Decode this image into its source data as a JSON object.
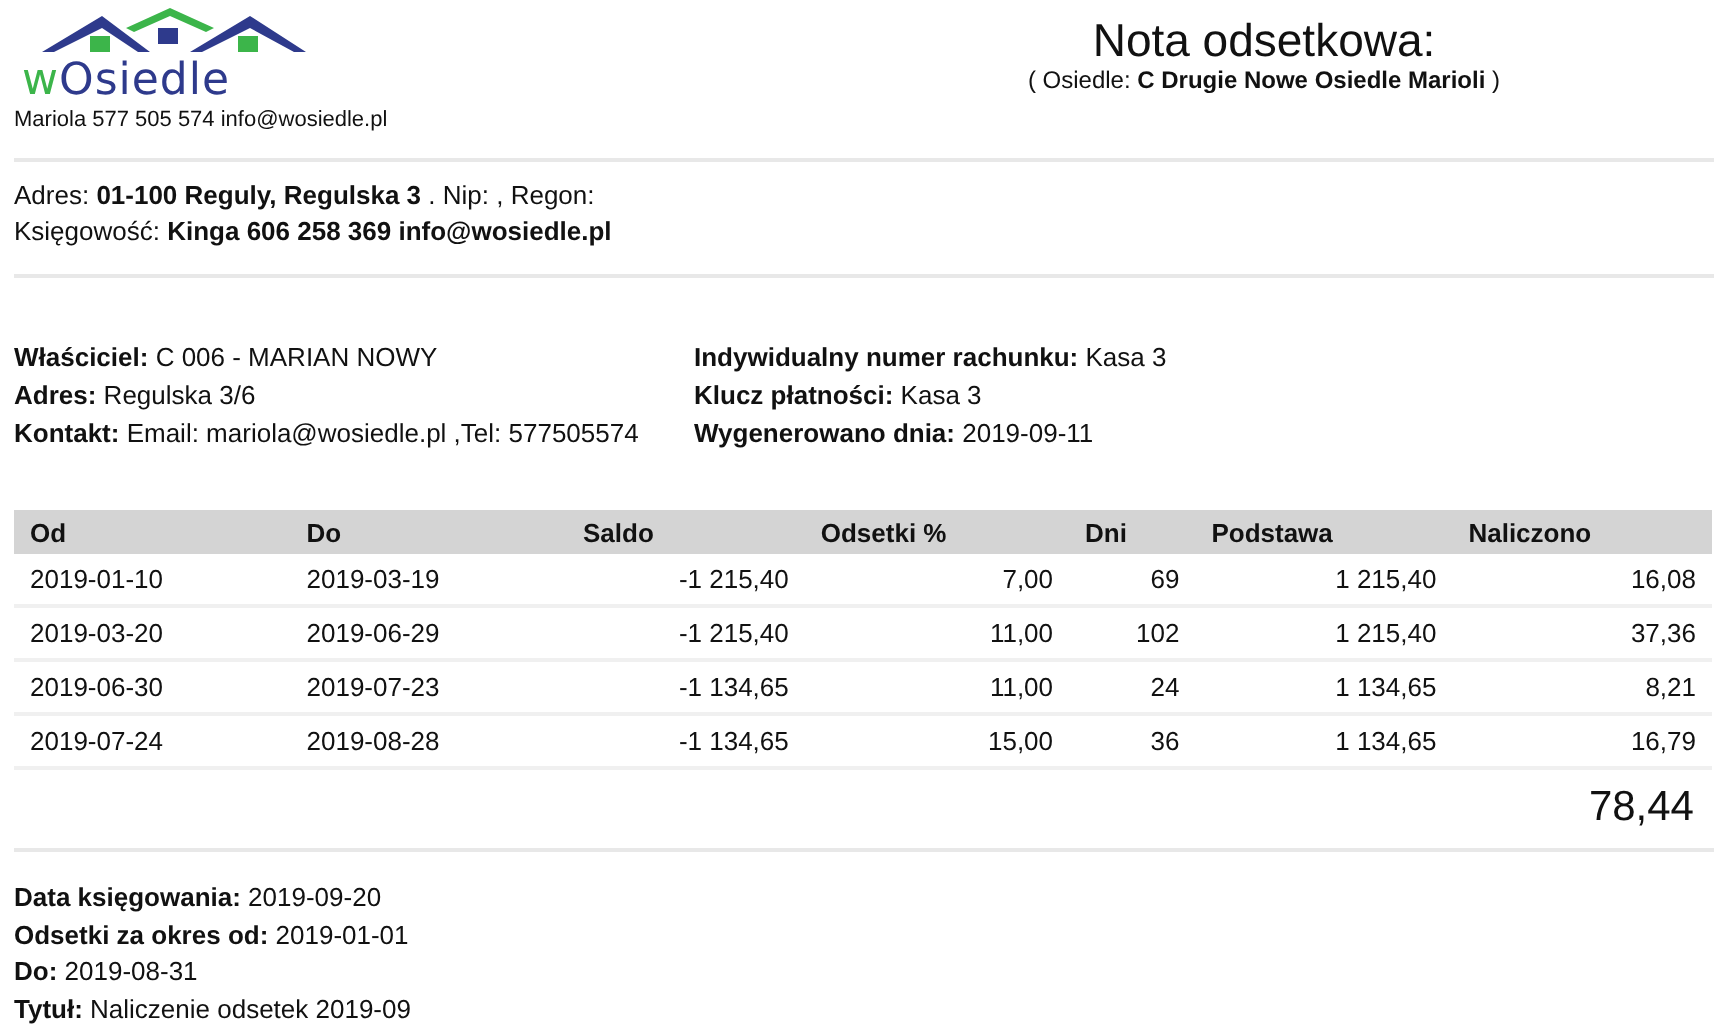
{
  "logo": {
    "prefix": "w",
    "name": "Osiedle"
  },
  "contact": "Mariola 577 505 574 info@wosiedle.pl",
  "title": "Nota odsetkowa:",
  "subtitle": "( Osiedle: **C Drugie Nowe Osiedle Marioli** )",
  "company": [
    "Adres: **01-100 Reguly, Regulska 3** . Nip: , Regon:",
    "Księgowość: **Kinga 606 258 369 info@wosiedle.pl**"
  ],
  "owner": [
    {
      "label": "Właściciel:",
      "value": "C 006 - MARIAN NOWY"
    },
    {
      "label": "Adres:",
      "value": "Regulska 3/6"
    },
    {
      "label": "Kontakt:",
      "value": "Email: mariola@wosiedle.pl ,Tel: 577505574"
    }
  ],
  "account": [
    {
      "label": "Indywidualny numer rachunku:",
      "value": "Kasa 3"
    },
    {
      "label": "Klucz płatności:",
      "value": "Kasa 3"
    },
    {
      "label": "Wygenerowano dnia:",
      "value": "2019-09-11"
    }
  ],
  "table": {
    "columns": [
      {
        "label": "Od",
        "kind": "text"
      },
      {
        "label": "Do",
        "kind": "text"
      },
      {
        "label": "Saldo",
        "kind": "number"
      },
      {
        "label": "Odsetki %",
        "kind": "number"
      },
      {
        "label": "Dni",
        "kind": "number"
      },
      {
        "label": "Podstawa",
        "kind": "number"
      },
      {
        "label": "Naliczono",
        "kind": "number"
      }
    ],
    "rows": [
      [
        "2019-01-10",
        "2019-03-19",
        "-1 215,40",
        "7,00",
        "69",
        "1 215,40",
        "16,08"
      ],
      [
        "2019-03-20",
        "2019-06-29",
        "-1 215,40",
        "11,00",
        "102",
        "1 215,40",
        "37,36"
      ],
      [
        "2019-06-30",
        "2019-07-23",
        "-1 134,65",
        "11,00",
        "24",
        "1 134,65",
        "8,21"
      ],
      [
        "2019-07-24",
        "2019-08-28",
        "-1 134,65",
        "15,00",
        "36",
        "1 134,65",
        "16,79"
      ]
    ],
    "total": "78,44"
  },
  "footer": [
    {
      "label": "Data księgowania:",
      "value": "2019-09-20"
    },
    {
      "label": "Odsetki za okres od:",
      "value": "2019-01-01"
    },
    {
      "label": "Do:",
      "value": "2019-08-31"
    },
    {
      "label": "Tytuł:",
      "value": "Naliczenie odsetek 2019-09"
    }
  ]
}
